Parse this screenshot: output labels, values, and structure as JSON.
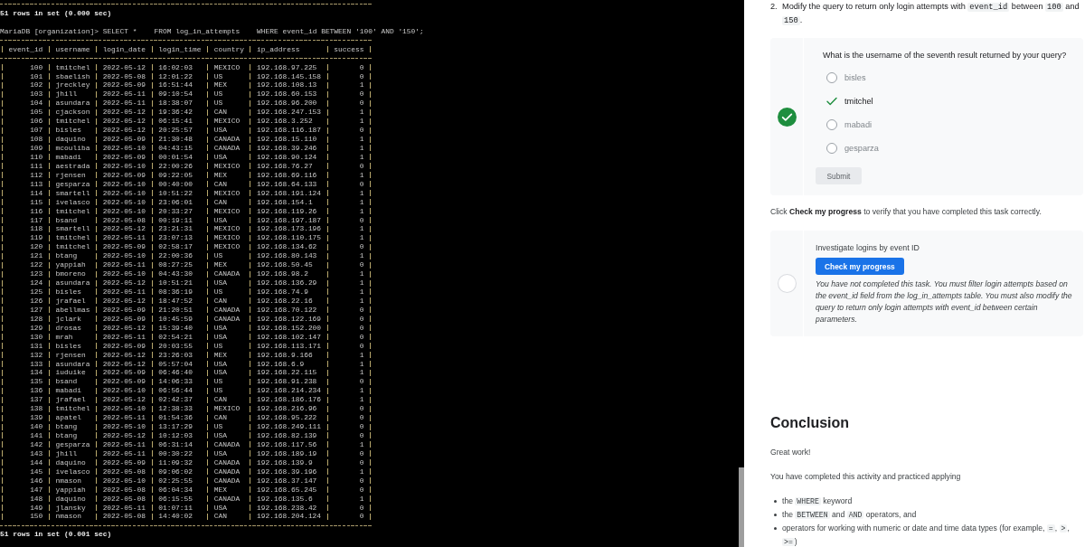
{
  "terminal": {
    "previous_status": "51 rows in set (0.000 sec)",
    "prompt": "MariaDB [organization]>",
    "command": "SELECT *    FROM log_in_attempts    WHERE event_id BETWEEN '100' AND '150';",
    "result_table": {
      "columns": [
        {
          "label": "event_id",
          "kind": "number"
        },
        {
          "label": "username",
          "kind": "text"
        },
        {
          "label": "login_date",
          "kind": "text"
        },
        {
          "label": "login_time",
          "kind": "text"
        },
        {
          "label": "country",
          "kind": "text"
        },
        {
          "label": "ip_address",
          "kind": "text"
        },
        {
          "label": "success",
          "kind": "number"
        }
      ],
      "rows": [
        [
          "100",
          "tmitchel",
          "2022-05-12",
          "16:02:03",
          "MEXICO",
          "192.168.97.225",
          "0"
        ],
        [
          "101",
          "sbaelish",
          "2022-05-08",
          "12:01:22",
          "US",
          "192.168.145.158",
          "0"
        ],
        [
          "102",
          "jreckley",
          "2022-05-09",
          "16:51:44",
          "MEX",
          "192.168.108.13",
          "1"
        ],
        [
          "103",
          "jhill",
          "2022-05-11",
          "09:10:54",
          "US",
          "192.168.60.153",
          "0"
        ],
        [
          "104",
          "asundara",
          "2022-05-11",
          "18:38:07",
          "US",
          "192.168.96.200",
          "0"
        ],
        [
          "105",
          "cjackson",
          "2022-05-12",
          "19:36:42",
          "CAN",
          "192.168.247.153",
          "1"
        ],
        [
          "106",
          "tmitchel",
          "2022-05-12",
          "06:15:41",
          "MEXICO",
          "192.168.3.252",
          "1"
        ],
        [
          "107",
          "bisles",
          "2022-05-12",
          "20:25:57",
          "USA",
          "192.168.116.187",
          "0"
        ],
        [
          "108",
          "daquino",
          "2022-05-09",
          "21:30:48",
          "CANADA",
          "192.168.15.110",
          "1"
        ],
        [
          "109",
          "mcouliba",
          "2022-05-10",
          "04:43:15",
          "CANADA",
          "192.168.39.246",
          "1"
        ],
        [
          "110",
          "mabadi",
          "2022-05-09",
          "00:01:54",
          "USA",
          "192.168.90.124",
          "1"
        ],
        [
          "111",
          "aestrada",
          "2022-05-10",
          "22:00:26",
          "MEXICO",
          "192.168.76.27",
          "0"
        ],
        [
          "112",
          "rjensen",
          "2022-05-09",
          "09:22:05",
          "MEX",
          "192.168.69.116",
          "1"
        ],
        [
          "113",
          "gesparza",
          "2022-05-10",
          "00:40:00",
          "CAN",
          "192.168.64.133",
          "0"
        ],
        [
          "114",
          "smartell",
          "2022-05-10",
          "10:51:22",
          "MEXICO",
          "192.168.191.124",
          "1"
        ],
        [
          "115",
          "ivelasco",
          "2022-05-10",
          "23:06:01",
          "CAN",
          "192.168.154.1",
          "1"
        ],
        [
          "116",
          "tmitchel",
          "2022-05-10",
          "20:33:27",
          "MEXICO",
          "192.168.119.26",
          "1"
        ],
        [
          "117",
          "bsand",
          "2022-05-08",
          "00:19:11",
          "USA",
          "192.168.197.187",
          "0"
        ],
        [
          "118",
          "smartell",
          "2022-05-12",
          "23:21:31",
          "MEXICO",
          "192.168.173.196",
          "1"
        ],
        [
          "119",
          "tmitchel",
          "2022-05-11",
          "23:07:13",
          "MEXICO",
          "192.168.110.175",
          "1"
        ],
        [
          "120",
          "tmitchel",
          "2022-05-09",
          "02:58:17",
          "MEXICO",
          "192.168.134.62",
          "0"
        ],
        [
          "121",
          "btang",
          "2022-05-10",
          "22:00:36",
          "US",
          "192.168.80.143",
          "1"
        ],
        [
          "122",
          "yappiah",
          "2022-05-11",
          "08:27:25",
          "MEX",
          "192.168.50.45",
          "0"
        ],
        [
          "123",
          "bmoreno",
          "2022-05-10",
          "04:43:30",
          "CANADA",
          "192.168.98.2",
          "1"
        ],
        [
          "124",
          "asundara",
          "2022-05-12",
          "10:51:21",
          "USA",
          "192.168.136.29",
          "1"
        ],
        [
          "125",
          "bisles",
          "2022-05-11",
          "08:36:19",
          "US",
          "192.168.74.9",
          "1"
        ],
        [
          "126",
          "jrafael",
          "2022-05-12",
          "18:47:52",
          "CAN",
          "192.168.22.16",
          "1"
        ],
        [
          "127",
          "abellmas",
          "2022-05-09",
          "21:20:51",
          "CANADA",
          "192.168.70.122",
          "0"
        ],
        [
          "128",
          "jclark",
          "2022-05-09",
          "10:45:59",
          "CANADA",
          "192.168.122.169",
          "0"
        ],
        [
          "129",
          "drosas",
          "2022-05-12",
          "15:39:40",
          "USA",
          "192.168.152.200",
          "0"
        ],
        [
          "130",
          "mrah",
          "2022-05-11",
          "02:54:21",
          "USA",
          "192.168.102.147",
          "0"
        ],
        [
          "131",
          "bisles",
          "2022-05-09",
          "20:03:55",
          "US",
          "192.168.113.171",
          "0"
        ],
        [
          "132",
          "rjensen",
          "2022-05-12",
          "23:26:03",
          "MEX",
          "192.168.9.166",
          "1"
        ],
        [
          "133",
          "asundara",
          "2022-05-12",
          "05:57:04",
          "USA",
          "192.168.6.9",
          "1"
        ],
        [
          "134",
          "iuduike",
          "2022-05-09",
          "06:46:40",
          "USA",
          "192.168.22.115",
          "1"
        ],
        [
          "135",
          "bsand",
          "2022-05-09",
          "14:06:33",
          "US",
          "192.168.91.238",
          "0"
        ],
        [
          "136",
          "mabadi",
          "2022-05-10",
          "06:56:44",
          "US",
          "192.168.214.234",
          "1"
        ],
        [
          "137",
          "jrafael",
          "2022-05-12",
          "02:42:37",
          "CAN",
          "192.168.186.176",
          "1"
        ],
        [
          "138",
          "tmitchel",
          "2022-05-10",
          "12:38:33",
          "MEXICO",
          "192.168.216.96",
          "0"
        ],
        [
          "139",
          "apatel",
          "2022-05-11",
          "01:54:36",
          "CAN",
          "192.168.95.222",
          "0"
        ],
        [
          "140",
          "btang",
          "2022-05-10",
          "13:17:29",
          "US",
          "192.168.249.111",
          "0"
        ],
        [
          "141",
          "btang",
          "2022-05-12",
          "10:12:03",
          "USA",
          "192.168.82.139",
          "0"
        ],
        [
          "142",
          "gesparza",
          "2022-05-11",
          "06:31:14",
          "CANADA",
          "192.168.117.56",
          "1"
        ],
        [
          "143",
          "jhill",
          "2022-05-11",
          "00:30:22",
          "USA",
          "192.168.189.19",
          "0"
        ],
        [
          "144",
          "daquino",
          "2022-05-09",
          "11:09:32",
          "CANADA",
          "192.168.139.9",
          "0"
        ],
        [
          "145",
          "ivelasco",
          "2022-05-08",
          "09:06:02",
          "CANADA",
          "192.168.39.196",
          "1"
        ],
        [
          "146",
          "nmason",
          "2022-05-10",
          "02:25:55",
          "CANADA",
          "192.168.37.147",
          "0"
        ],
        [
          "147",
          "yappiah",
          "2022-05-08",
          "06:04:34",
          "MEX",
          "192.168.65.245",
          "0"
        ],
        [
          "148",
          "daquino",
          "2022-05-08",
          "06:15:55",
          "CANADA",
          "192.168.135.6",
          "1"
        ],
        [
          "149",
          "jlansky",
          "2022-05-11",
          "01:07:11",
          "USA",
          "192.168.238.42",
          "0"
        ],
        [
          "150",
          "nmason",
          "2022-05-08",
          "14:40:02",
          "CAN",
          "192.168.204.124",
          "0"
        ]
      ]
    },
    "status": "51 rows in set (0.001 sec)"
  },
  "step": {
    "number": "2.",
    "parts": [
      {
        "text": "Modify the query to return only login attempts with ",
        "kind": "text"
      },
      {
        "text": "event_id",
        "kind": "code"
      },
      {
        "text": " between ",
        "kind": "text"
      },
      {
        "text": "100",
        "kind": "code"
      },
      {
        "text": " and ",
        "kind": "text"
      },
      {
        "text": "150",
        "kind": "code"
      },
      {
        "text": ".",
        "kind": "text"
      }
    ]
  },
  "quiz": {
    "completed": true,
    "question": "What is the username of the seventh result returned by your query?",
    "options": [
      {
        "label": "bisles",
        "selected": false
      },
      {
        "label": "tmitchel",
        "selected": true
      },
      {
        "label": "mabadi",
        "selected": false
      },
      {
        "label": "gesparza",
        "selected": false
      }
    ],
    "submit": "Submit"
  },
  "progress_hint": "Click **Check my progress** to verify that you have completed this task correctly.",
  "progress_card": {
    "completed": false,
    "title": "Investigate logins by event ID",
    "button": "Check my progress",
    "message": "You have not completed this task. You must filter login attempts based on the event_id field from the log_in_attempts table. You must also modify the query to return only login attempts with event_id between certain parameters."
  },
  "conclusion": {
    "heading": "Conclusion",
    "paragraphs": [
      "Great work!",
      "You have completed this activity and practiced applying"
    ],
    "bullets": [
      [
        {
          "text": "the ",
          "kind": "text"
        },
        {
          "text": "WHERE",
          "kind": "code"
        },
        {
          "text": " keyword",
          "kind": "text"
        }
      ],
      [
        {
          "text": "the ",
          "kind": "text"
        },
        {
          "text": "BETWEEN",
          "kind": "code"
        },
        {
          "text": " and ",
          "kind": "text"
        },
        {
          "text": "AND",
          "kind": "code"
        },
        {
          "text": " operators, and",
          "kind": "text"
        }
      ],
      [
        {
          "text": "operators for working with numeric or date and time data types (for example, ",
          "kind": "text"
        },
        {
          "text": "=",
          "kind": "code"
        },
        {
          "text": ", ",
          "kind": "text"
        },
        {
          "text": ">",
          "kind": "code"
        },
        {
          "text": ", ",
          "kind": "text"
        },
        {
          "text": ">=",
          "kind": "code"
        },
        {
          "text": ")",
          "kind": "text"
        }
      ]
    ]
  }
}
